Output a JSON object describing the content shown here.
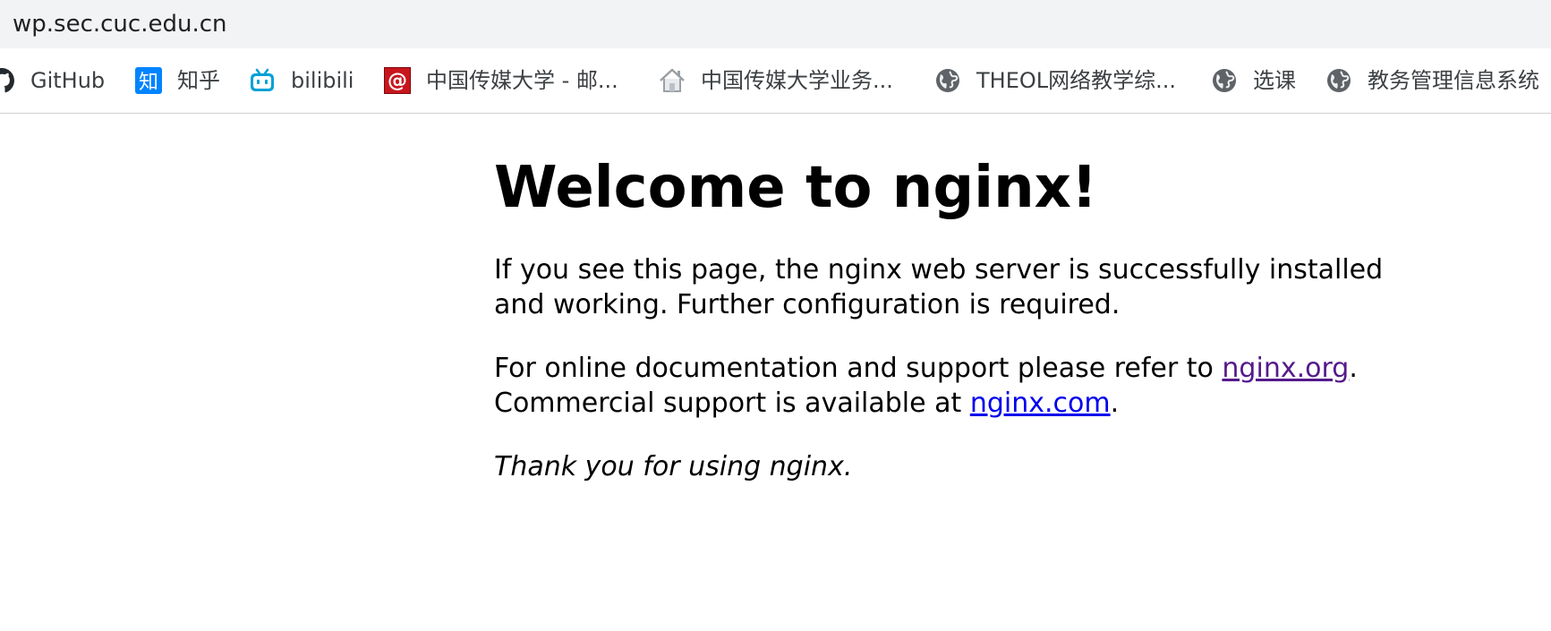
{
  "browser": {
    "url": "wp.sec.cuc.edu.cn",
    "bookmarks": [
      {
        "label": "GitHub",
        "icon": "github-icon"
      },
      {
        "label": "知乎",
        "icon": "zhihu-icon",
        "icon_text": "知"
      },
      {
        "label": "bilibili",
        "icon": "bilibili-icon"
      },
      {
        "label": "中国传媒大学 - 邮...",
        "icon": "mail-at-icon",
        "icon_text": "@"
      },
      {
        "label": "中国传媒大学业务...",
        "icon": "home-icon"
      },
      {
        "label": "THEOL网络教学综...",
        "icon": "globe-icon"
      },
      {
        "label": "选课",
        "icon": "globe-icon"
      },
      {
        "label": "教务管理信息系统",
        "icon": "globe-icon"
      }
    ]
  },
  "page": {
    "heading": "Welcome to nginx!",
    "p1": "If you see this page, the nginx web server is successfully installed and working. Further configuration is required.",
    "p2_prefix": "For online documentation and support please refer to ",
    "p2_link1": "nginx.org",
    "p2_mid": ".",
    "p2_line2_prefix": "Commercial support is available at ",
    "p2_link2": "nginx.com",
    "p2_suffix": ".",
    "p3": "Thank you for using nginx."
  },
  "colors": {
    "toolbar_bg": "#f1f3f4",
    "link": "#0000ee",
    "visited_link": "#551a8b",
    "zhihu_blue": "#0084ff",
    "bilibili_blue": "#00a1d6",
    "mail_red": "#c8161d"
  }
}
